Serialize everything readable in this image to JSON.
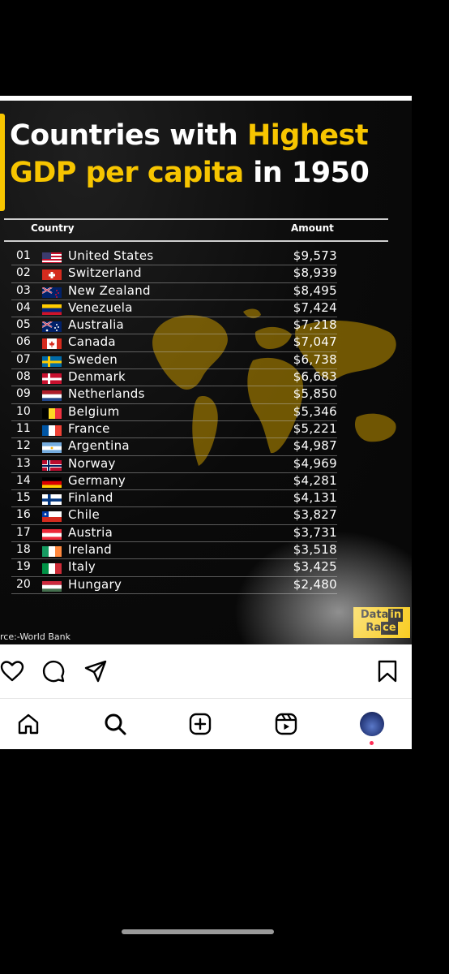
{
  "post": {
    "title_part1": "Countries with ",
    "title_highlight1": "Highest",
    "title_highlight2": "GDP per capita",
    "title_part2": " in 1950",
    "table": {
      "headers": [
        "Country",
        "Amount"
      ],
      "rows": [
        {
          "rank": "01",
          "country": "United States",
          "amount": "$9,573",
          "flag": "us-flag"
        },
        {
          "rank": "02",
          "country": "Switzerland",
          "amount": "$8,939",
          "flag": "ch-flag"
        },
        {
          "rank": "03",
          "country": "New Zealand",
          "amount": "$8,495",
          "flag": "nz-flag"
        },
        {
          "rank": "04",
          "country": "Venezuela",
          "amount": "$7,424",
          "flag": "ve-flag"
        },
        {
          "rank": "05",
          "country": "Australia",
          "amount": "$7,218",
          "flag": "au-flag"
        },
        {
          "rank": "06",
          "country": "Canada",
          "amount": "$7,047",
          "flag": "ca-flag"
        },
        {
          "rank": "07",
          "country": "Sweden",
          "amount": "$6,738",
          "flag": "se-flag"
        },
        {
          "rank": "08",
          "country": "Denmark",
          "amount": "$6,683",
          "flag": "dk-flag"
        },
        {
          "rank": "09",
          "country": "Netherlands",
          "amount": "$5,850",
          "flag": "nl-flag"
        },
        {
          "rank": "10",
          "country": "Belgium",
          "amount": "$5,346",
          "flag": "be-flag"
        },
        {
          "rank": "11",
          "country": "France",
          "amount": "$5,221",
          "flag": "fr-flag"
        },
        {
          "rank": "12",
          "country": "Argentina",
          "amount": "$4,987",
          "flag": "ar-flag"
        },
        {
          "rank": "13",
          "country": "Norway",
          "amount": "$4,969",
          "flag": "no-flag"
        },
        {
          "rank": "14",
          "country": "Germany",
          "amount": "$4,281",
          "flag": "de-flag"
        },
        {
          "rank": "15",
          "country": "Finland",
          "amount": "$4,131",
          "flag": "fi-flag"
        },
        {
          "rank": "16",
          "country": "Chile",
          "amount": "$3,827",
          "flag": "cl-flag"
        },
        {
          "rank": "17",
          "country": "Austria",
          "amount": "$3,731",
          "flag": "at-flag"
        },
        {
          "rank": "18",
          "country": "Ireland",
          "amount": "$3,518",
          "flag": "ie-flag"
        },
        {
          "rank": "19",
          "country": "Italy",
          "amount": "$3,425",
          "flag": "it-flag"
        },
        {
          "rank": "20",
          "country": "Hungary",
          "amount": "$2,480",
          "flag": "hu-flag"
        }
      ]
    },
    "source": "rce:-World Bank",
    "logo_line1_a": "Data",
    "logo_line1_b": "in",
    "logo_line2_a": "Ra",
    "logo_line2_b": "ce"
  },
  "actions": [
    "heart-icon",
    "comment-icon",
    "share-icon",
    "bookmark-icon"
  ],
  "nav": [
    "home-icon",
    "search-icon",
    "create-icon",
    "reels-icon",
    "profile-avatar"
  ],
  "colors": {
    "accent": "#f7c500",
    "background": "#000000",
    "bar": "#ffffff",
    "notification": "#ff2d55"
  }
}
